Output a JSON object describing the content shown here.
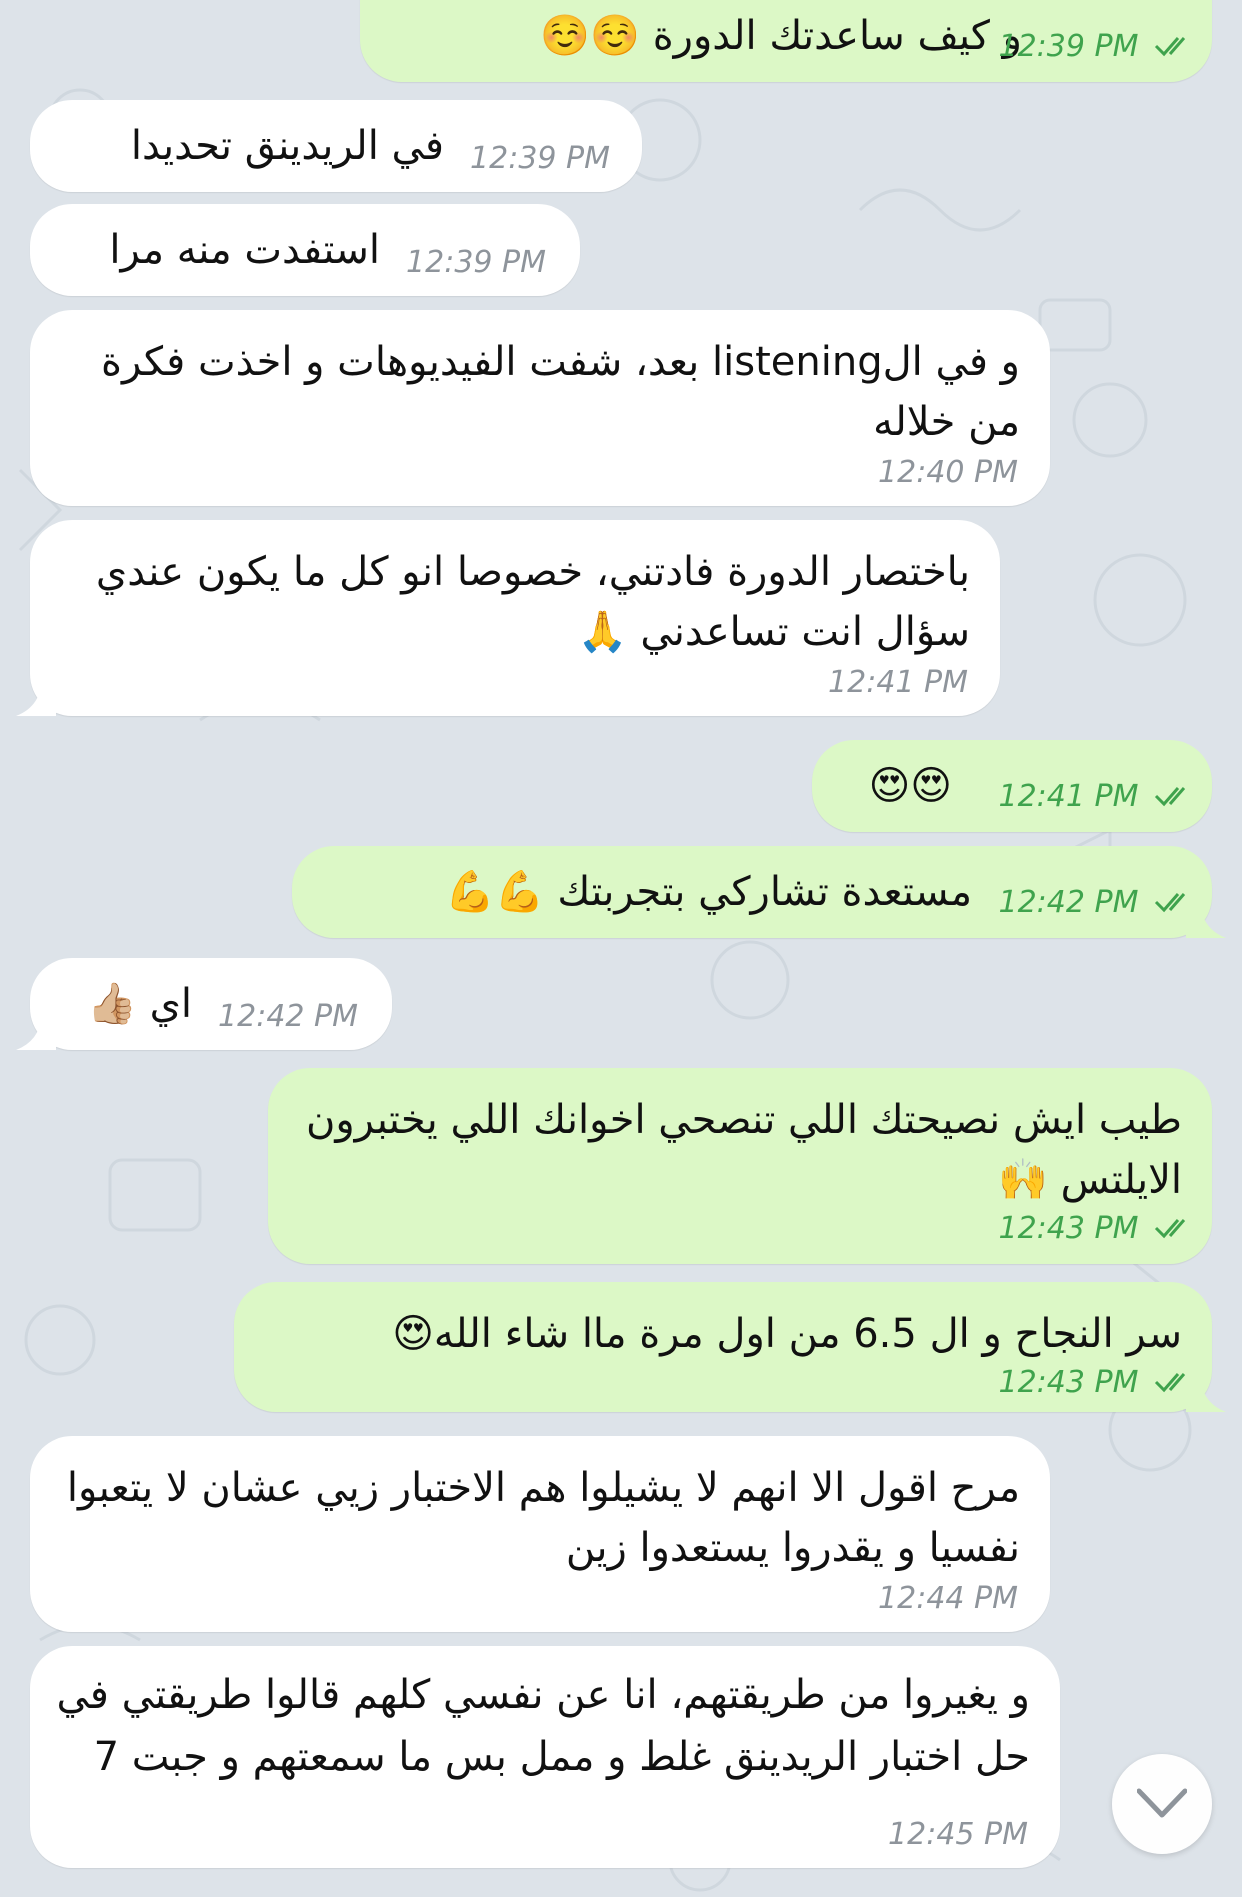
{
  "messages": [
    {
      "direction": "out",
      "text": "و كيف ساعدتك الدورة ☺️☺️",
      "time": "12:39 PM"
    },
    {
      "direction": "in",
      "text": "في الريدينق تحديدا",
      "time": "12:39 PM"
    },
    {
      "direction": "in",
      "text": "استفدت منه مرا",
      "time": "12:39 PM"
    },
    {
      "direction": "in",
      "text": "و في الlistening بعد، شفت الفيديوهات و اخذت فكرة من خلاله",
      "time": "12:40 PM"
    },
    {
      "direction": "in",
      "text": "باختصار الدورة فادتني، خصوصا انو كل ما يكون عندي سؤال انت تساعدني 🙏",
      "time": "12:41 PM"
    },
    {
      "direction": "out",
      "text": "😍😍",
      "time": "12:41 PM"
    },
    {
      "direction": "out",
      "text": "مستعدة تشاركي بتجربتك 💪💪",
      "time": "12:42 PM"
    },
    {
      "direction": "in",
      "text": "اي 👍🏼",
      "time": "12:42 PM"
    },
    {
      "direction": "out",
      "text": "طيب ايش نصيحتك اللي تنصحي اخوانك اللي يختبرون الايلتس 🙌",
      "time": "12:43 PM"
    },
    {
      "direction": "out",
      "text": "سر النجاح و ال 6.5 من اول مرة ماا شاء الله😍",
      "time": "12:43 PM"
    },
    {
      "direction": "in",
      "text": "مرح اقول الا انهم لا يشيلوا هم الاختبار زيي عشان لا يتعبوا نفسيا و يقدروا يستعدوا زين",
      "time": "12:44 PM"
    },
    {
      "direction": "in",
      "text": "و يغيروا من طريقتهم، انا عن نفسي كلهم قالوا طريقتي في حل اختبار الريدينق غلط و ممل بس ما سمعتهم و جبت 7",
      "time": "12:45 PM"
    }
  ],
  "colors": {
    "incoming_bubble": "#ffffff",
    "outgoing_bubble": "#dcf8c6",
    "outgoing_time": "#3fa34d",
    "incoming_time": "#8e949b",
    "background": "#dde3e9"
  },
  "icons": {
    "read_receipt": "double-check-icon",
    "scroll_down": "chevron-down-icon"
  }
}
